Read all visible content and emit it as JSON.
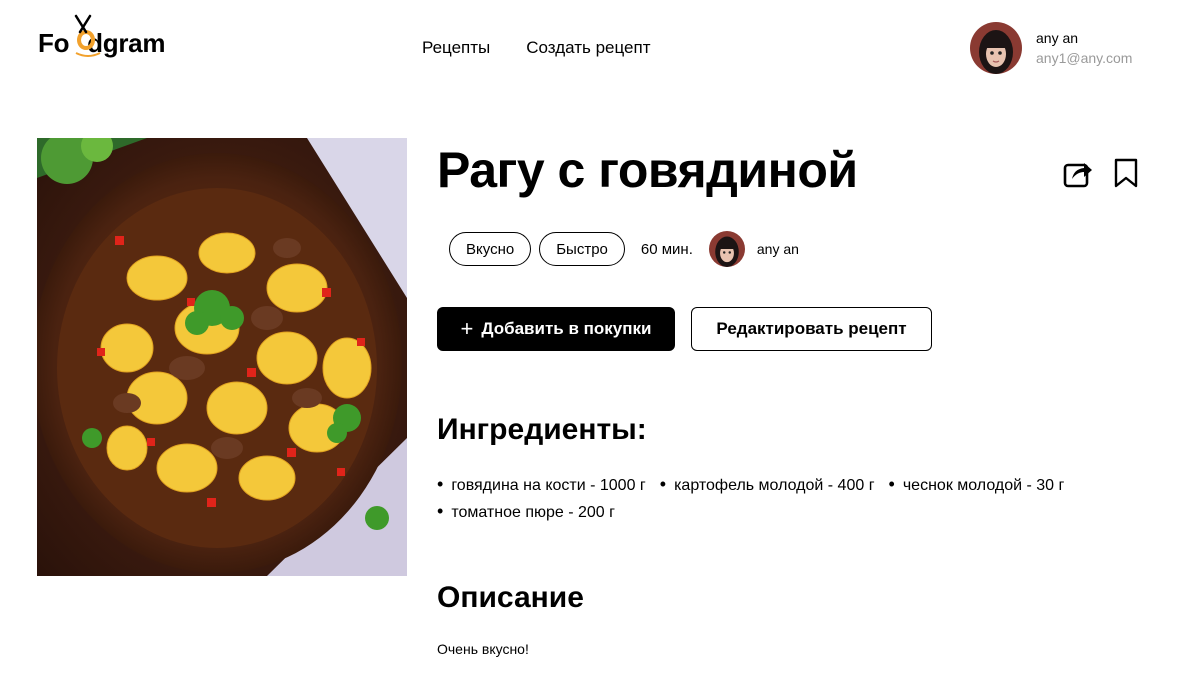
{
  "brand": {
    "logo_text": "Foodgram",
    "accent": "#f2a12c"
  },
  "nav": {
    "recipes": "Рецепты",
    "create": "Создать рецепт"
  },
  "user": {
    "name": "any an",
    "email": "any1@any.com"
  },
  "recipe": {
    "title": "Рагу с говядиной",
    "tags": [
      "Вкусно",
      "Быстро"
    ],
    "time": "60 мин.",
    "author": "any an",
    "add_to_cart_label": "Добавить в покупки",
    "add_icon": "+",
    "edit_label": "Редактировать рецепт",
    "ingredients_heading": "Ингредиенты:",
    "ingredients": [
      "говядина на кости - 1000 г",
      "картофель молодой - 400 г",
      "чеснок молодой - 30 г",
      "томатное пюре - 200 г"
    ],
    "description_heading": "Описание",
    "description": "Очень вкусно!"
  },
  "icons": {
    "share": "share-icon",
    "favorite": "bookmark-icon"
  }
}
